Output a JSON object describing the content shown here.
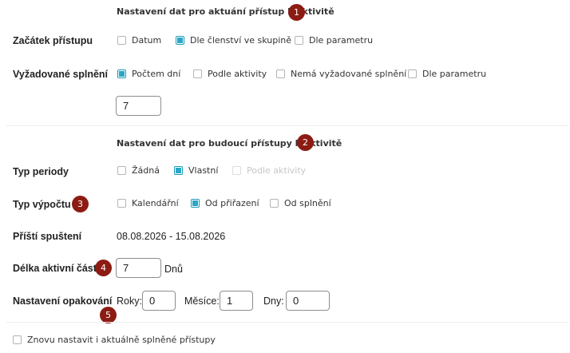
{
  "current_section": {
    "title": "Nastavení dat pro aktuání přístup k aktivitě",
    "badge": "1",
    "access_start": {
      "label": "Začátek přístupu",
      "options": [
        {
          "label": "Datum",
          "checked": false
        },
        {
          "label": "Dle členství ve skupině",
          "checked": true
        },
        {
          "label": "Dle parametru",
          "checked": false
        }
      ]
    },
    "required_completion": {
      "label": "Vyžadované splnění",
      "options": [
        {
          "label": "Počtem dní",
          "checked": true
        },
        {
          "label": "Podle aktivity",
          "checked": false
        },
        {
          "label": "Nemá vyžadované splnění",
          "checked": false
        },
        {
          "label": "Dle parametru",
          "checked": false
        }
      ],
      "days_value": "7"
    }
  },
  "future_section": {
    "title": "Nastavení dat pro budoucí přístupy k aktivitě",
    "badge": "2",
    "period_type": {
      "label": "Typ periody",
      "options": [
        {
          "label": "Žádná",
          "checked": false
        },
        {
          "label": "Vlastní",
          "checked": true
        },
        {
          "label": "Podle aktivity",
          "checked": false,
          "disabled": true
        }
      ]
    },
    "calc_type": {
      "label": "Typ výpočtu",
      "badge": "3",
      "options": [
        {
          "label": "Kalendářní",
          "checked": false
        },
        {
          "label": "Od přiřazení",
          "checked": true
        },
        {
          "label": "Od splnění",
          "checked": false
        }
      ]
    },
    "next_run": {
      "label": "Příští spuštení",
      "value": "08.08.2026 - 15.08.2026"
    },
    "active_length": {
      "label": "Délka aktivní části",
      "badge": "4",
      "value": "7",
      "unit": "Dnů"
    },
    "repeat": {
      "label": "Nastavení opakování",
      "badge": "5",
      "years_label": "Roky:",
      "years_value": "0",
      "months_label": "Měsíce:",
      "months_value": "1",
      "days_label": "Dny:",
      "days_value": "0"
    }
  },
  "reset_option": {
    "label": "Znovu nastavit i aktuálně splněné přístupy",
    "checked": false
  },
  "colors": {
    "accent": "#2aa7c4",
    "badge": "#8c1c13"
  }
}
